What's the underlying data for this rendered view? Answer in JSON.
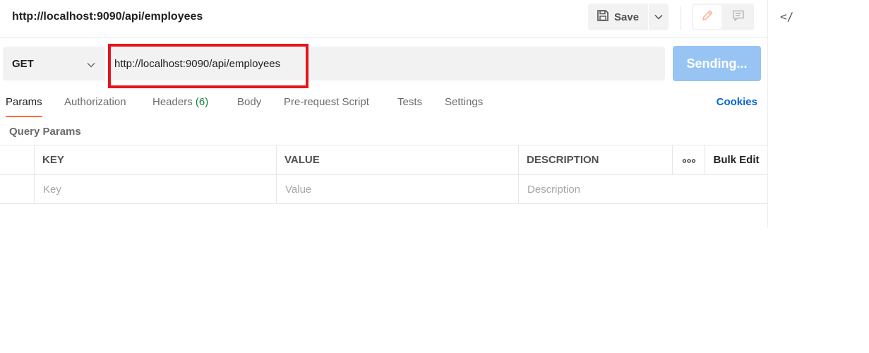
{
  "request": {
    "title": "http://localhost:9090/api/employees",
    "method": "GET",
    "url": "http://localhost:9090/api/employees"
  },
  "toolbar": {
    "save_label": "Save",
    "send_label": "Sending..."
  },
  "tabs": {
    "params": "Params",
    "authorization": "Authorization",
    "headers": "Headers",
    "headers_count": "(6)",
    "body": "Body",
    "prerequest": "Pre-request Script",
    "tests": "Tests",
    "settings": "Settings"
  },
  "cookies_label": "Cookies",
  "query_params": {
    "section_label": "Query Params",
    "columns": {
      "key": "KEY",
      "value": "VALUE",
      "description": "DESCRIPTION",
      "bulk_edit": "Bulk Edit"
    },
    "placeholders": {
      "key": "Key",
      "value": "Value",
      "description": "Description"
    }
  },
  "code_panel_glyph": "</",
  "colors": {
    "accent_tab": "#ff6c37",
    "send_button": "#97c4f3",
    "cookies_link": "#0265d2",
    "highlight_box": "#e3151f",
    "headers_count": "#0c8043"
  },
  "icons": [
    "save-icon",
    "chevron-down-icon",
    "pencil-icon",
    "comment-icon",
    "code-icon",
    "more-options-icon"
  ]
}
